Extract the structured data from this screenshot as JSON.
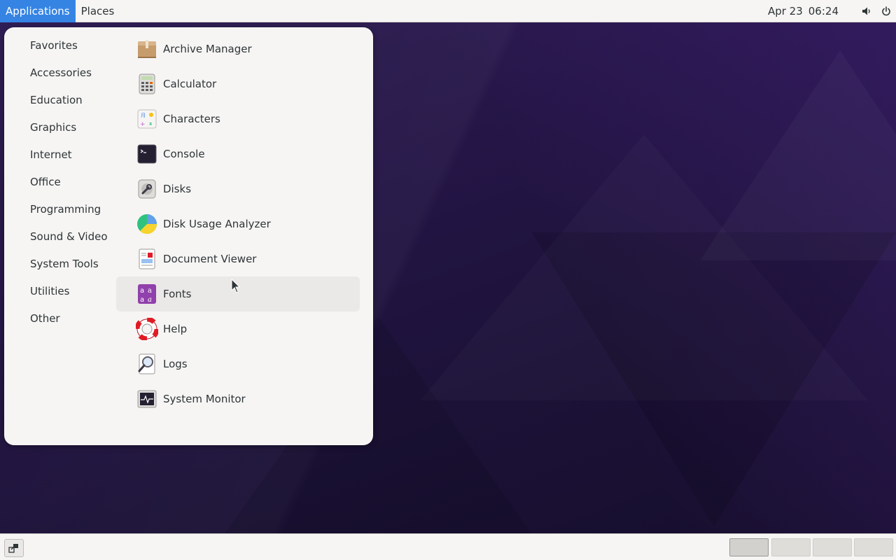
{
  "top_panel": {
    "applications_label": "Applications",
    "places_label": "Places",
    "clock": {
      "date": "Apr 23",
      "time": "06:24"
    },
    "tray_icons": [
      "volume-icon",
      "power-icon"
    ]
  },
  "app_menu": {
    "categories": [
      {
        "label": "Favorites"
      },
      {
        "label": "Accessories"
      },
      {
        "label": "Education"
      },
      {
        "label": "Graphics"
      },
      {
        "label": "Internet"
      },
      {
        "label": "Office"
      },
      {
        "label": "Programming"
      },
      {
        "label": "Sound & Video"
      },
      {
        "label": "System Tools"
      },
      {
        "label": "Utilities"
      },
      {
        "label": "Other"
      }
    ],
    "apps": [
      {
        "label": "Archive Manager",
        "icon": "archive-manager-icon"
      },
      {
        "label": "Calculator",
        "icon": "calculator-icon"
      },
      {
        "label": "Characters",
        "icon": "characters-icon"
      },
      {
        "label": "Console",
        "icon": "console-icon"
      },
      {
        "label": "Disks",
        "icon": "disks-icon"
      },
      {
        "label": "Disk Usage Analyzer",
        "icon": "disk-usage-analyzer-icon"
      },
      {
        "label": "Document Viewer",
        "icon": "document-viewer-icon"
      },
      {
        "label": "Fonts",
        "icon": "fonts-icon"
      },
      {
        "label": "Help",
        "icon": "help-icon"
      },
      {
        "label": "Logs",
        "icon": "logs-icon"
      },
      {
        "label": "System Monitor",
        "icon": "system-monitor-icon"
      }
    ],
    "hovered_app": "Fonts"
  },
  "bottom_panel": {
    "show_desktop_icon": "show-desktop-icon",
    "workspaces": 4,
    "current_workspace": 1
  },
  "colors": {
    "panel_bg": "#f6f5f4",
    "accent": "#3584e4",
    "wallpaper": "#241546"
  }
}
